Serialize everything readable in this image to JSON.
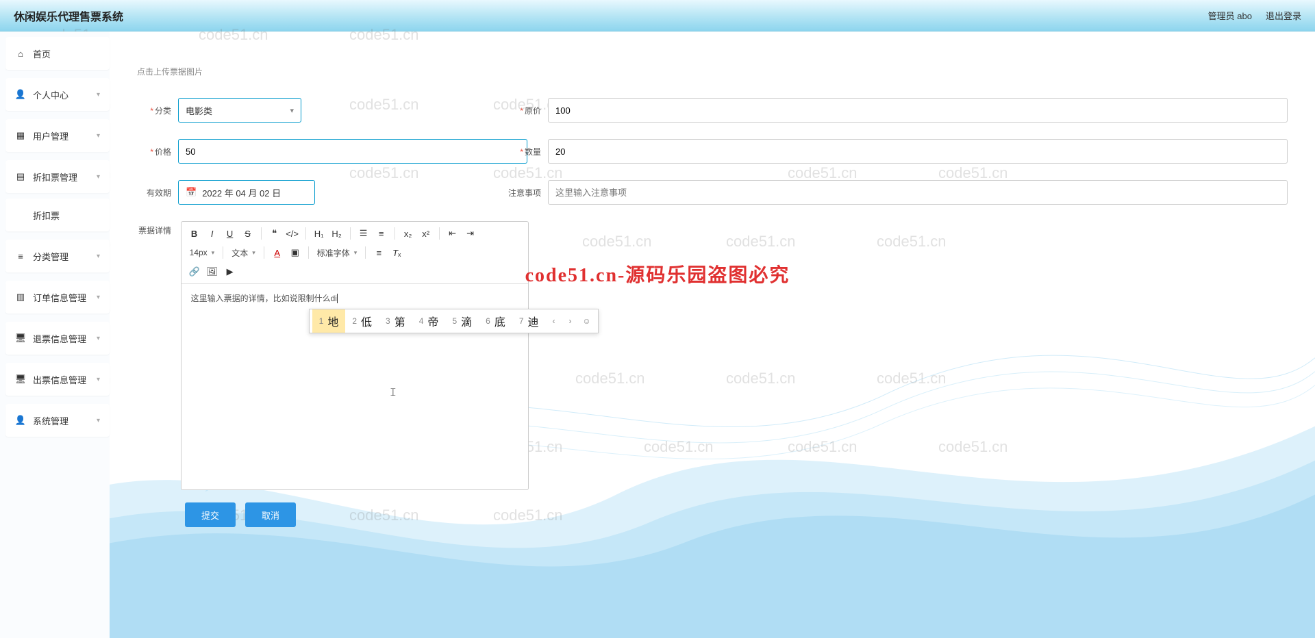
{
  "header": {
    "title": "休闲娱乐代理售票系统",
    "admin_label": "管理员 abo",
    "logout_label": "退出登录"
  },
  "sidebar": {
    "items": [
      {
        "label": "首页",
        "icon": "home",
        "expandable": false
      },
      {
        "label": "个人中心",
        "icon": "user",
        "expandable": true
      },
      {
        "label": "用户管理",
        "icon": "grid",
        "expandable": true
      },
      {
        "label": "折扣票管理",
        "icon": "bars",
        "expandable": true
      },
      {
        "label": "折扣票",
        "icon": "",
        "expandable": false,
        "child": true
      },
      {
        "label": "分类管理",
        "icon": "list",
        "expandable": true
      },
      {
        "label": "订单信息管理",
        "icon": "orders",
        "expandable": true
      },
      {
        "label": "退票信息管理",
        "icon": "monitor",
        "expandable": true
      },
      {
        "label": "出票信息管理",
        "icon": "monitor",
        "expandable": true
      },
      {
        "label": "系统管理",
        "icon": "user",
        "expandable": true
      }
    ]
  },
  "form": {
    "upload_hint": "点击上传票据图片",
    "category_label": "分类",
    "category_value": "电影类",
    "original_price_label": "原价",
    "original_price_value": "100",
    "price_label": "价格",
    "price_value": "50",
    "quantity_label": "数量",
    "quantity_value": "20",
    "expiry_label": "有效期",
    "expiry_value": "2022 年 04 月 02 日",
    "notes_label": "注意事项",
    "notes_placeholder": "这里输入注意事项",
    "details_label": "票据详情",
    "editor_content": "这里输入票据的详情，比如说限制什么di",
    "submit_label": "提交",
    "cancel_label": "取消"
  },
  "editor_toolbar": {
    "font_size": "14px",
    "font_family": "文本",
    "font_preset": "标准字体"
  },
  "ime": {
    "options": [
      {
        "num": "1",
        "char": "地"
      },
      {
        "num": "2",
        "char": "低"
      },
      {
        "num": "3",
        "char": "第"
      },
      {
        "num": "4",
        "char": "帝"
      },
      {
        "num": "5",
        "char": "滴"
      },
      {
        "num": "6",
        "char": "底"
      },
      {
        "num": "7",
        "char": "迪"
      }
    ]
  },
  "watermark": {
    "main": "code51.cn-源码乐园盗图必究",
    "small": "code51.cn"
  }
}
